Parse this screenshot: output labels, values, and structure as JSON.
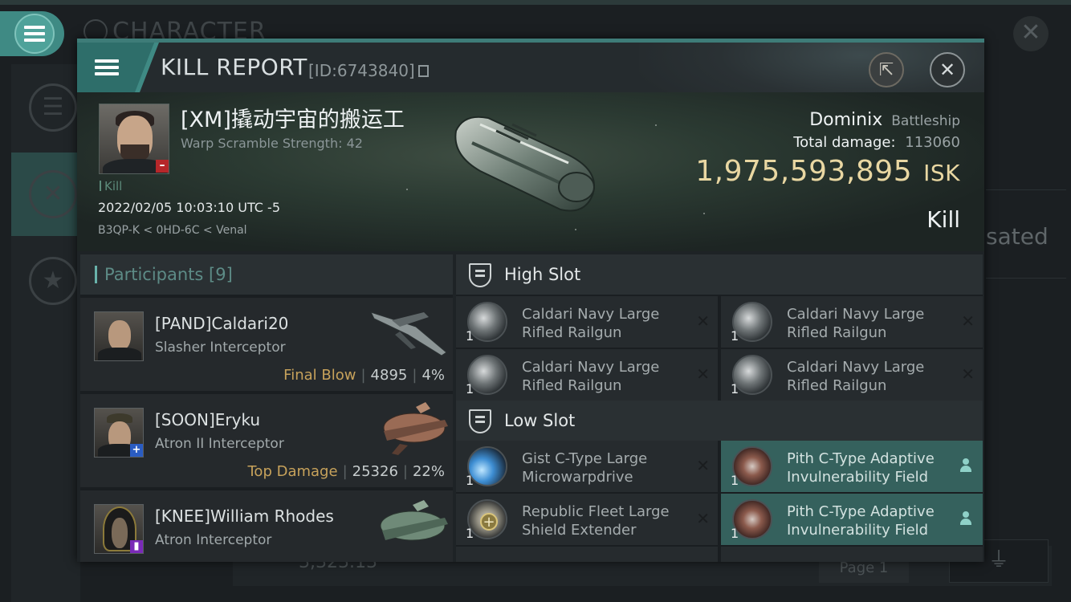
{
  "background": {
    "title": "CHARACTER",
    "right_text": "sated",
    "page_label": "Page 1",
    "skill_points": "3,323.13"
  },
  "header": {
    "title": "KILL REPORT",
    "id_label": "[ID:6743840]"
  },
  "victim": {
    "name": "[XM]撬动宇宙的搬运工",
    "warp_scramble": "Warp Scramble Strength: 42",
    "tag": "Kill",
    "datetime": "2022/02/05 10:03:10 UTC -5",
    "location": "B3QP-K < 0HD-6C < Venal",
    "ship_name": "Dominix",
    "ship_class": "Battleship",
    "total_damage_label": "Total damage:",
    "total_damage": "113060",
    "isk_value": "1,975,593,895",
    "isk_unit": "ISK",
    "result": "Kill"
  },
  "participants": {
    "label": "Participants",
    "count": "[9]",
    "rows": [
      {
        "name": "[PAND]Caldari20",
        "ship": "Slasher Interceptor",
        "role": "Final Blow",
        "damage": "4895",
        "percent": "4%"
      },
      {
        "name": "[SOON]Eryku",
        "ship": "Atron II Interceptor",
        "role": "Top Damage",
        "damage": "25326",
        "percent": "22%"
      },
      {
        "name": "[KNEE]William Rhodes",
        "ship": "Atron Interceptor",
        "role": "",
        "damage": "",
        "percent": ""
      }
    ]
  },
  "fitting": {
    "high_slot": {
      "label": "High Slot",
      "modules": [
        {
          "qty": "1",
          "name": "Caldari Navy Large Rifled Railgun"
        },
        {
          "qty": "1",
          "name": "Caldari Navy Large Rifled Railgun"
        },
        {
          "qty": "1",
          "name": "Caldari Navy Large Rifled Railgun"
        },
        {
          "qty": "1",
          "name": "Caldari Navy Large Rifled Railgun"
        }
      ]
    },
    "low_slot": {
      "label": "Low Slot",
      "modules": [
        {
          "qty": "1",
          "name": "Gist C-Type Large Microwarpdrive"
        },
        {
          "qty": "1",
          "name": "Pith C-Type Adaptive Invulnerability Field"
        },
        {
          "qty": "1",
          "name": "Republic Fleet Large Shield Extender"
        },
        {
          "qty": "1",
          "name": "Pith C-Type Adaptive Invulnerability Field"
        }
      ]
    }
  },
  "colors": {
    "accent": "#3f8a84",
    "isk": "#e9d7a2",
    "role": "#c7a25b",
    "dropped_row": "#35615d"
  }
}
